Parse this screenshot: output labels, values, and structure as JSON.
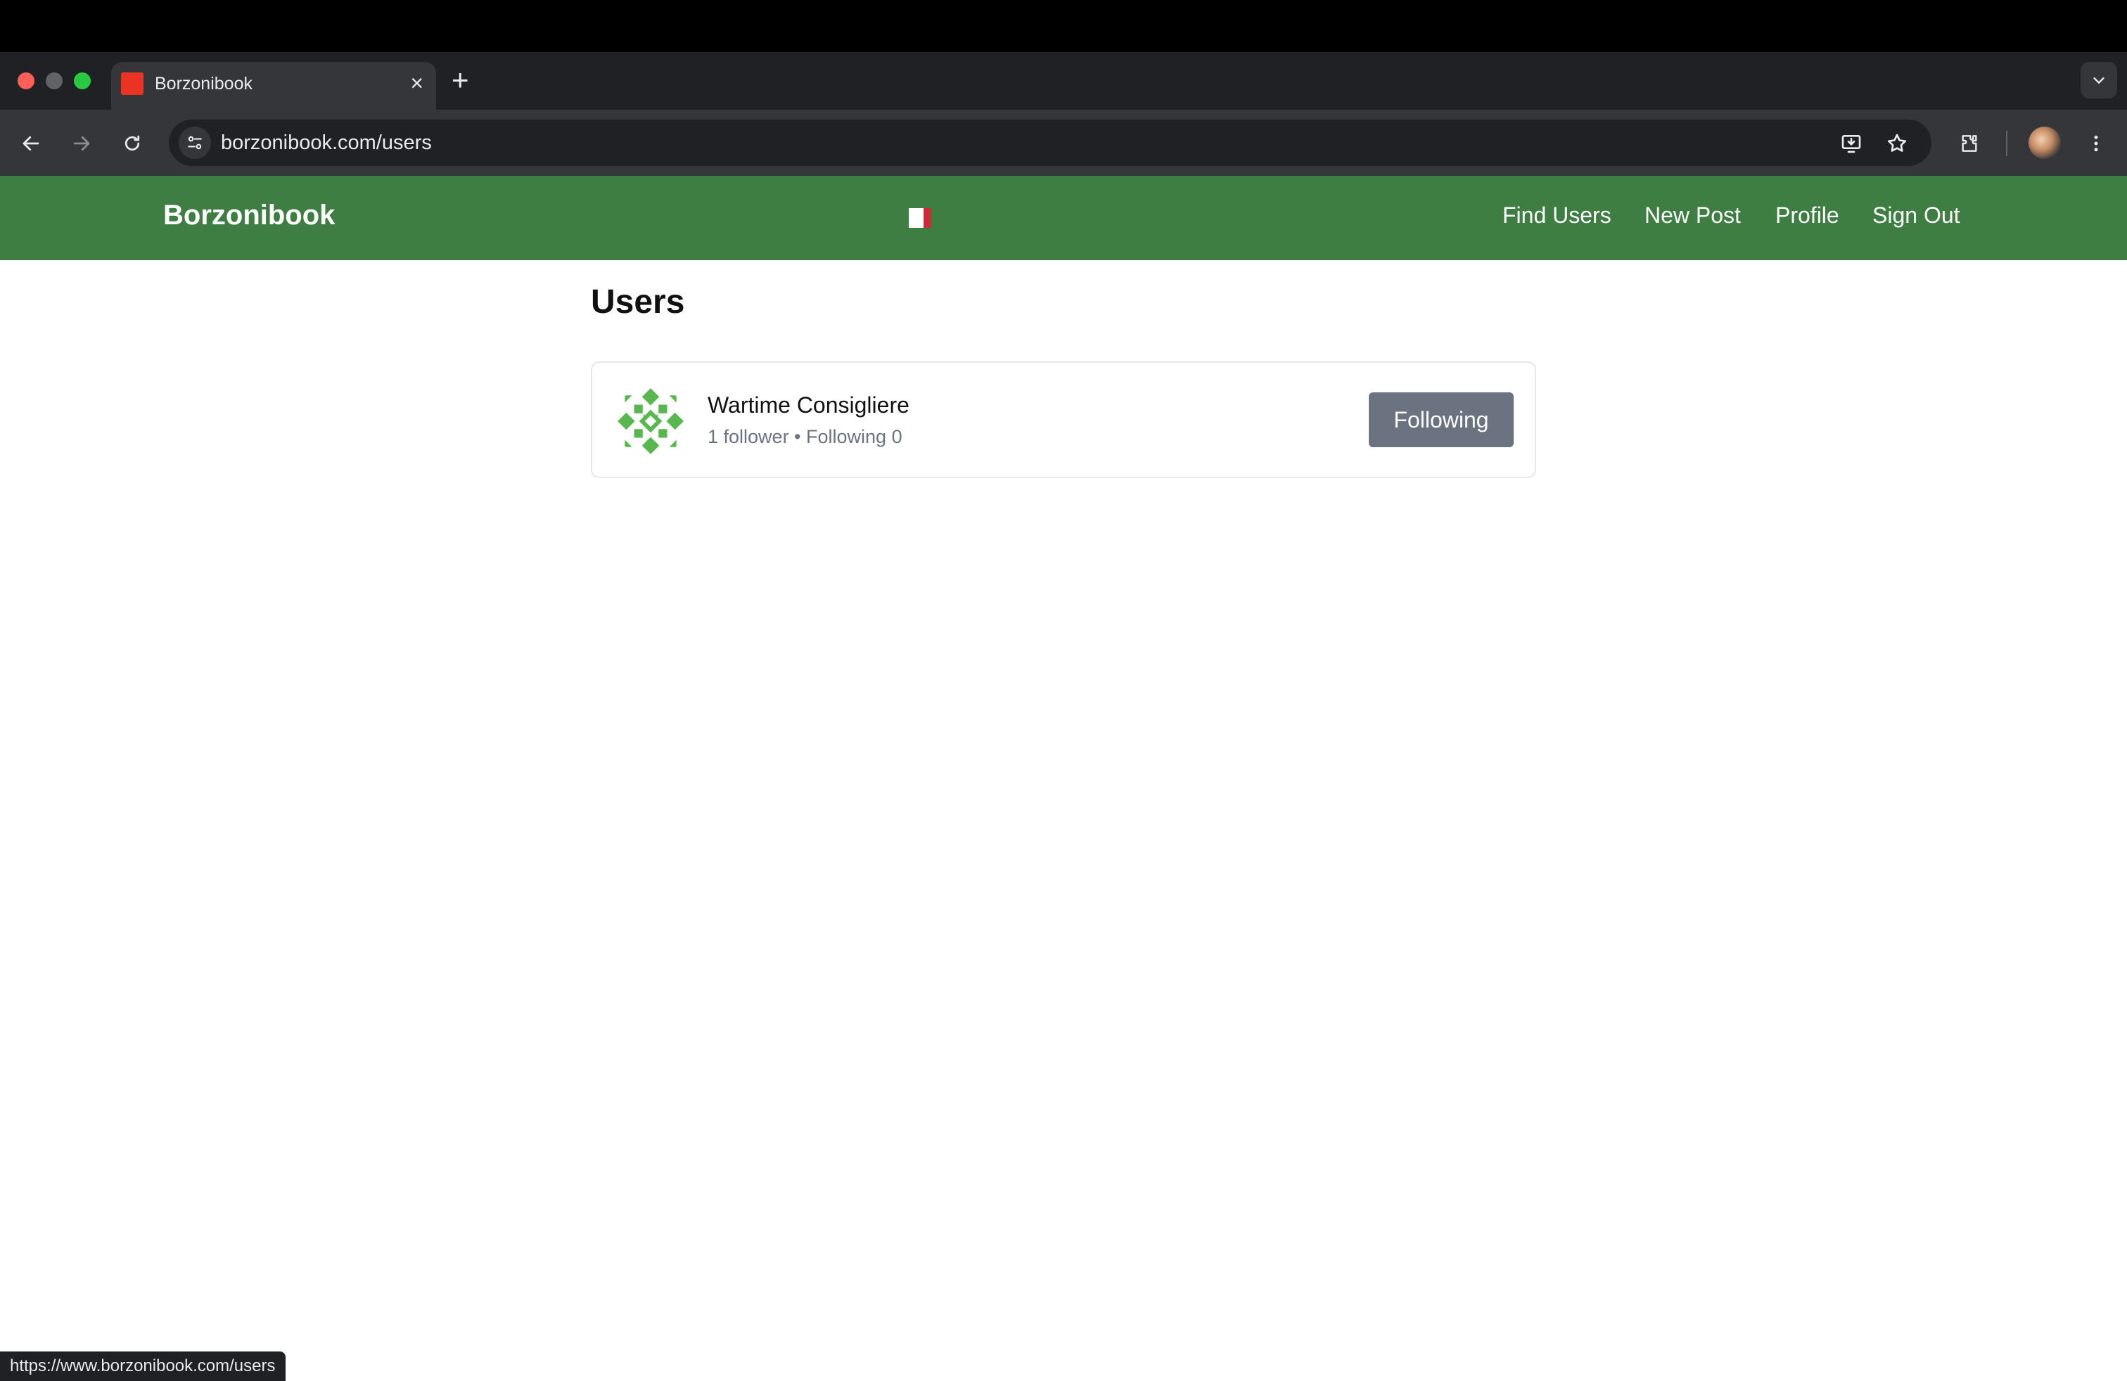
{
  "browser": {
    "tab_title": "Borzonibook",
    "tab_close_glyph": "×",
    "new_tab_glyph": "+",
    "url": "borzonibook.com/users",
    "status_url": "https://www.borzonibook.com/users",
    "icons": [
      "back-icon",
      "forward-icon",
      "reload-icon",
      "site-info-icon",
      "install-app-icon",
      "bookmark-star-icon",
      "extensions-icon",
      "profile-avatar",
      "more-menu-icon",
      "tab-search-chevron-icon"
    ]
  },
  "header": {
    "brand": "Borzonibook",
    "flag": "italian-flag",
    "nav": {
      "find_users": "Find Users",
      "new_post": "New Post",
      "profile": "Profile",
      "sign_out": "Sign Out"
    },
    "color": "#3e7e43"
  },
  "main": {
    "title": "Users",
    "users": [
      {
        "name": "Wartime Consigliere",
        "stats": "1 follower • Following 0",
        "button_label": "Following"
      }
    ]
  },
  "colors": {
    "accent_green": "#3e7e43",
    "avatar_green": "#58b84e",
    "button_gray": "#6b7280",
    "favicon_red": "#ea3323"
  }
}
